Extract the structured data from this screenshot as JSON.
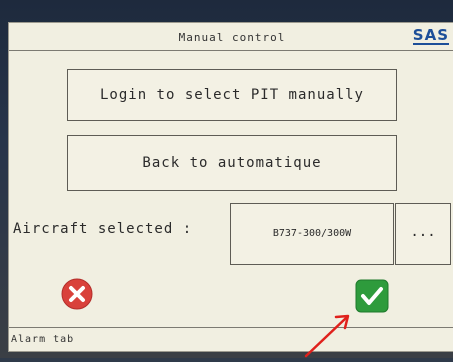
{
  "window": {
    "title": "Manual control",
    "logo_text": "SAS"
  },
  "buttons": {
    "login_label": "Login to select PIT manually",
    "back_label": "Back to automatique"
  },
  "aircraft": {
    "label": "Aircraft selected :",
    "value": "B737-300/300W",
    "more_label": "..."
  },
  "actions": {
    "cancel_icon": "close-icon",
    "confirm_icon": "check-icon",
    "cancel_color": "#d9413b",
    "confirm_color": "#2e9b3c"
  },
  "status": {
    "alarm_tab_label": "Alarm tab"
  },
  "annotation": {
    "arrow_color": "#e0211c"
  }
}
